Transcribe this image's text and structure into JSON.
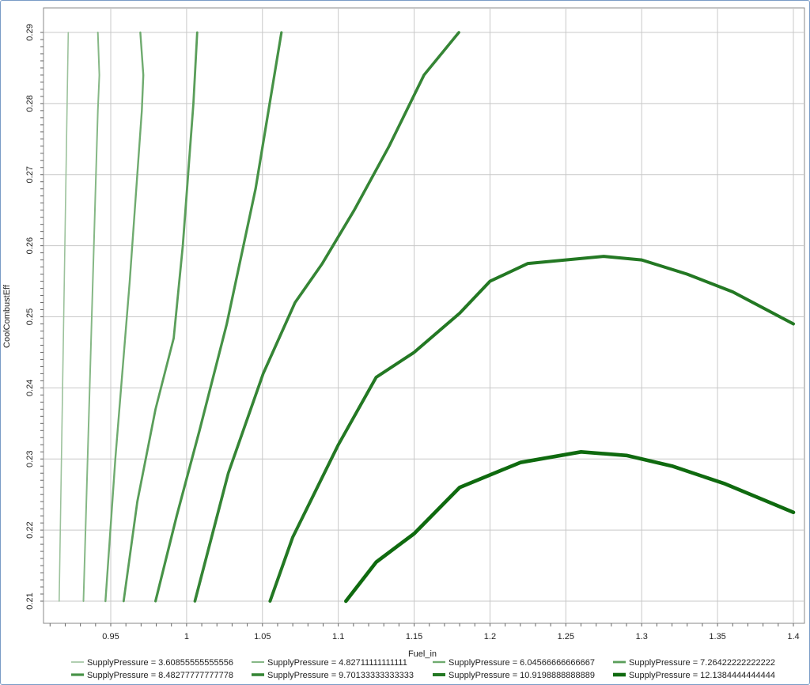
{
  "chart_data": {
    "type": "line",
    "chart_subtype": "contour",
    "title": "",
    "xlabel": "Fuel_in",
    "ylabel": "CoolCombustEff",
    "xlim": [
      0.91,
      1.4
    ],
    "ylim": [
      0.21,
      0.29
    ],
    "xticks": [
      "0.95",
      "1",
      "1.05",
      "1.1",
      "1.15",
      "1.2",
      "1.25",
      "1.3",
      "1.35",
      "1.4"
    ],
    "xtick_values": [
      0.95,
      1.0,
      1.05,
      1.1,
      1.15,
      1.2,
      1.25,
      1.3,
      1.35,
      1.4
    ],
    "yticks": [
      "0.21",
      "0.22",
      "0.23",
      "0.24",
      "0.25",
      "0.26",
      "0.27",
      "0.28",
      "0.29"
    ],
    "ytick_values": [
      0.21,
      0.22,
      0.23,
      0.24,
      0.25,
      0.26,
      0.27,
      0.28,
      0.29
    ],
    "grid": true,
    "legend_position": "bottom",
    "series": [
      {
        "name": "SupplyPressure = 3.60855555555556",
        "color": "#9cc29c",
        "x": [
          0.916,
          0.922
        ],
        "y": [
          0.21,
          0.29
        ]
      },
      {
        "name": "SupplyPressure = 4.82711111111111",
        "color": "#86b886",
        "x": [
          0.932,
          0.9375,
          0.9415,
          0.9425,
          0.9415
        ],
        "y": [
          0.21,
          0.25,
          0.279,
          0.284,
          0.29
        ]
      },
      {
        "name": "SupplyPressure = 6.04566666666667",
        "color": "#6fab6f",
        "x": [
          0.9465,
          0.953,
          0.9625,
          0.9705,
          0.9715,
          0.9695
        ],
        "y": [
          0.21,
          0.23,
          0.255,
          0.279,
          0.284,
          0.29
        ]
      },
      {
        "name": "SupplyPressure = 7.26422222222222",
        "color": "#5a9e5a",
        "x": [
          0.9585,
          0.9675,
          0.9795,
          0.9915,
          0.9975,
          1.0045,
          1.007
        ],
        "y": [
          0.21,
          0.224,
          0.237,
          0.247,
          0.26,
          0.28,
          0.29
        ]
      },
      {
        "name": "SupplyPressure = 8.48277777777778",
        "color": "#469246",
        "x": [
          0.9795,
          0.9935,
          1.0085,
          1.0265,
          1.0455,
          1.0625
        ],
        "y": [
          0.21,
          0.222,
          0.234,
          0.249,
          0.268,
          0.29
        ]
      },
      {
        "name": "SupplyPressure = 9.70133333333333",
        "color": "#358535",
        "x": [
          1.0055,
          1.0275,
          1.0505,
          1.0715,
          1.0895,
          1.1105,
          1.1335,
          1.1565,
          1.1795
        ],
        "y": [
          0.21,
          0.228,
          0.242,
          0.252,
          0.2575,
          0.265,
          0.274,
          0.284,
          0.29
        ]
      },
      {
        "name": "SupplyPressure = 10.9198888888889",
        "color": "#237823",
        "x": [
          1.055,
          1.07,
          1.1,
          1.125,
          1.15,
          1.18,
          1.2,
          1.225,
          1.275,
          1.3,
          1.33,
          1.36,
          1.4
        ],
        "y": [
          0.21,
          0.219,
          0.232,
          0.2415,
          0.245,
          0.2505,
          0.255,
          0.2575,
          0.2585,
          0.258,
          0.256,
          0.2535,
          0.249
        ]
      },
      {
        "name": "SupplyPressure = 12.1384444444444",
        "color": "#0f6a0f",
        "x": [
          1.105,
          1.125,
          1.15,
          1.18,
          1.22,
          1.26,
          1.29,
          1.32,
          1.355,
          1.4
        ],
        "y": [
          0.21,
          0.2155,
          0.2195,
          0.226,
          0.2295,
          0.231,
          0.2305,
          0.229,
          0.2265,
          0.2225
        ]
      }
    ]
  }
}
